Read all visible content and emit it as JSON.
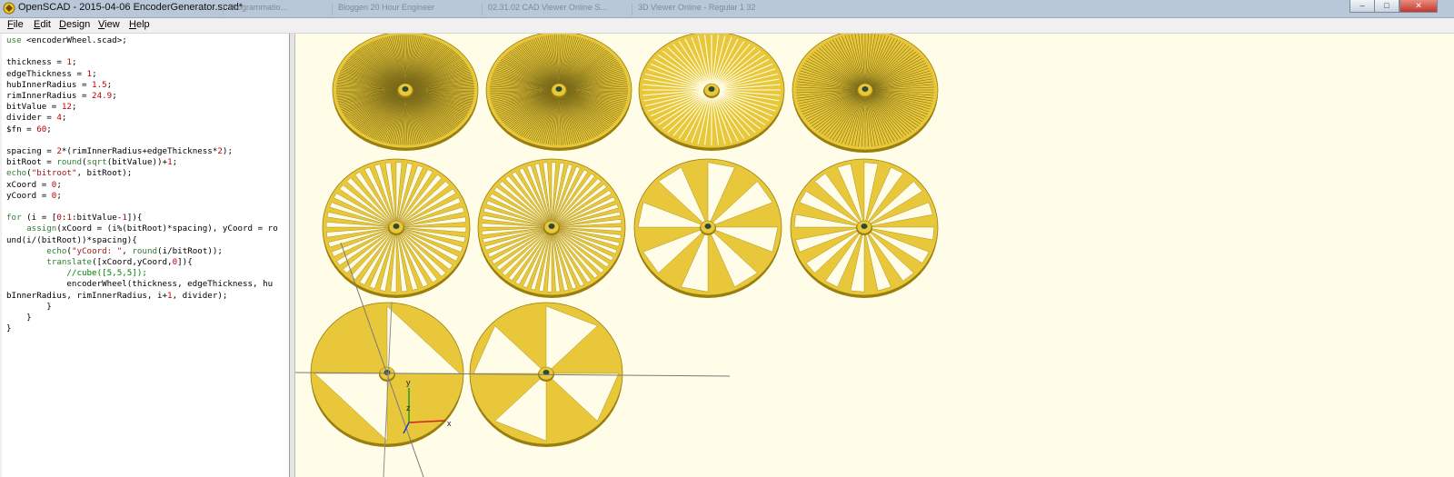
{
  "window": {
    "title": "OpenSCAD - 2015-04-06 EncoderGenerator.scad*",
    "background_tabs": [
      "Programmatio...",
      "Bloggen 20 Hour Engineer",
      "02.31.02 CAD Viewer Online S...",
      "3D Viewer Online - Regular 1 32"
    ],
    "controls": {
      "minimize": "–",
      "maximize": "□",
      "close": "✕"
    }
  },
  "menu": [
    {
      "mnemonic": "F",
      "rest": "ile"
    },
    {
      "mnemonic": "E",
      "rest": "dit"
    },
    {
      "mnemonic": "D",
      "rest": "esign"
    },
    {
      "mnemonic": "V",
      "rest": "iew"
    },
    {
      "mnemonic": "H",
      "rest": "elp"
    }
  ],
  "editor": {
    "code": "use <encoderWheel.scad>;\n\nthickness = 1;\nedgeThickness = 1;\nhubInnerRadius = 1.5;\nrimInnerRadius = 24.9;\nbitValue = 12;\ndivider = 4;\n$fn = 60;\n\nspacing = 2*(rimInnerRadius+edgeThickness*2);\nbitRoot = round(sqrt(bitValue))+1;\necho(\"bitroot\", bitRoot);\nxCoord = 0;\nyCoord = 0;\n\nfor (i = [0:1:bitValue-1]){\n    assign(xCoord = (i%(bitRoot)*spacing), yCoord = ro\nund(i/(bitRoot))*spacing){\n        echo(\"yCoord: \", round(i/bitRoot));\n        translate([xCoord,yCoord,0]){\n            //cube([5,5,5]);\n            encoderWheel(thickness, edgeThickness, hu\nbInnerRadius, rimInnerRadius, i+1, divider);\n        }\n    }\n}"
  },
  "viewport": {
    "background": "#fffde7",
    "model_color": "#e8c83a",
    "edge_color": "#9a7e0e",
    "axes_labels": {
      "x": "x",
      "y": "y",
      "z": "z"
    },
    "wheels": [
      {
        "row": 0,
        "col": 0,
        "spokes": 240,
        "texture": "moire"
      },
      {
        "row": 0,
        "col": 1,
        "spokes": 200,
        "texture": "moire"
      },
      {
        "row": 0,
        "col": 2,
        "spokes": 64,
        "texture": "fine"
      },
      {
        "row": 0,
        "col": 3,
        "spokes": 128,
        "texture": "moire"
      },
      {
        "row": 1,
        "col": 0,
        "spokes": 40
      },
      {
        "row": 1,
        "col": 1,
        "spokes": 52
      },
      {
        "row": 1,
        "col": 2,
        "spokes": 8
      },
      {
        "row": 1,
        "col": 3,
        "spokes": 16
      },
      {
        "row": 2,
        "col": 0,
        "spokes": 2
      },
      {
        "row": 2,
        "col": 1,
        "spokes": 4
      }
    ]
  }
}
